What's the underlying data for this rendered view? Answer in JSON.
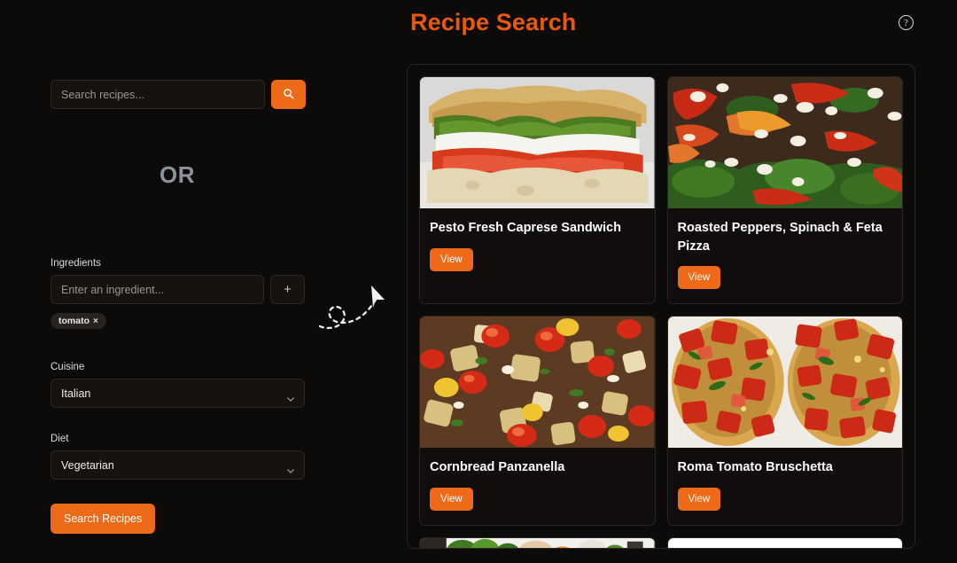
{
  "header": {
    "title": "Recipe Search",
    "help_icon": "help-circle-icon",
    "help_glyph": "?",
    "accent_color": "#e8590c"
  },
  "search": {
    "placeholder": "Search recipes...",
    "value": "",
    "button_icon": "search-icon"
  },
  "divider": {
    "label": "OR"
  },
  "ingredients": {
    "label": "Ingredients",
    "placeholder": "Enter an ingredient...",
    "value": "",
    "add_button_label": "+",
    "chips": [
      {
        "label": "tomato",
        "remove_glyph": "×"
      }
    ]
  },
  "cuisine": {
    "label": "Cuisine",
    "selected": "Italian",
    "chevron_icon": "chevron-down-icon"
  },
  "diet": {
    "label": "Diet",
    "selected": "Vegetarian",
    "chevron_icon": "chevron-down-icon"
  },
  "actions": {
    "search_recipes_label": "Search Recipes"
  },
  "decoration": {
    "cursor_icon": "mouse-cursor-arrow-icon",
    "trail": "dashed-loop-trail"
  },
  "results": {
    "button_label": "View",
    "cards": [
      {
        "title": "Pesto Fresh Caprese Sandwich",
        "image_name": "pesto-caprese-sandwich-photo",
        "view_label": "View"
      },
      {
        "title": "Roasted Peppers, Spinach & Feta Pizza",
        "image_name": "roasted-peppers-spinach-feta-pizza-photo",
        "view_label": "View"
      },
      {
        "title": "Cornbread Panzanella",
        "image_name": "cornbread-panzanella-photo",
        "view_label": "View"
      },
      {
        "title": "Roma Tomato Bruschetta",
        "image_name": "roma-tomato-bruschetta-photo",
        "view_label": "View"
      }
    ],
    "partial_cards": [
      {
        "image_name": "vegetable-dish-photo"
      },
      {
        "image_name": "white-plate-photo"
      }
    ]
  },
  "colors": {
    "background": "#0d0b0a",
    "accent_orange": "#ef6a18",
    "title_orange": "#e8590c",
    "panel_border": "#2a2522",
    "input_bg": "#16120f",
    "or_text": "#8d939c"
  }
}
